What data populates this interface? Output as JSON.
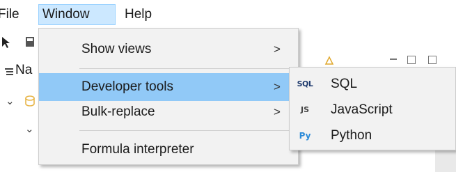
{
  "menubar": {
    "file_label": "File",
    "window_label": "Window",
    "help_label": "Help"
  },
  "background": {
    "nav_partial_label": "Na"
  },
  "window_menu": {
    "items": [
      {
        "label": "Show views",
        "arrow": ">"
      },
      {
        "label": "Developer tools",
        "arrow": ">"
      },
      {
        "label": "Bulk-replace",
        "arrow": ">"
      },
      {
        "label": "Formula interpreter"
      }
    ],
    "highlighted": "Developer tools"
  },
  "developer_tools_menu": {
    "items": [
      {
        "label": "SQL",
        "icon_name": "sql-icon",
        "icon_text": "SQL"
      },
      {
        "label": "JavaScript",
        "icon_name": "javascript-icon",
        "icon_text": "JS"
      },
      {
        "label": "Python",
        "icon_name": "python-icon",
        "icon_text": "Py"
      }
    ]
  },
  "colors": {
    "menu_highlight": "#91c9f7",
    "menubar_active": "#cce8ff"
  }
}
